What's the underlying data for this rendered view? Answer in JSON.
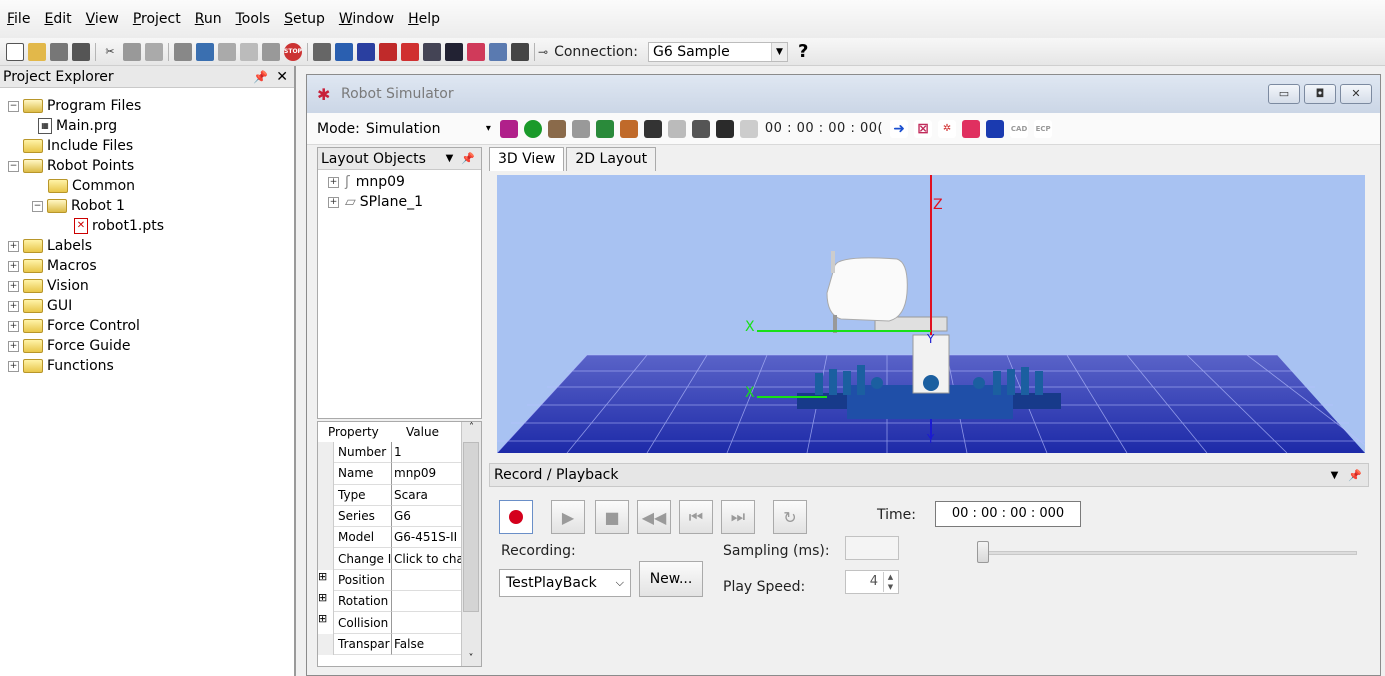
{
  "menu": [
    "File",
    "Edit",
    "View",
    "Project",
    "Run",
    "Tools",
    "Setup",
    "Window",
    "Help"
  ],
  "toolbar": {
    "connection_label": "Connection:",
    "connection_value": "G6 Sample",
    "help": "?"
  },
  "explorer": {
    "title": "Project Explorer",
    "items": [
      {
        "label": "Program Files"
      },
      {
        "label": "Main.prg"
      },
      {
        "label": "Include Files"
      },
      {
        "label": "Robot Points"
      },
      {
        "label": "Common"
      },
      {
        "label": "Robot 1"
      },
      {
        "label": "robot1.pts"
      },
      {
        "label": "Labels"
      },
      {
        "label": "Macros"
      },
      {
        "label": "Vision"
      },
      {
        "label": "GUI"
      },
      {
        "label": "Force Control"
      },
      {
        "label": "Force Guide"
      },
      {
        "label": "Functions"
      }
    ]
  },
  "simulator": {
    "title": "Robot Simulator",
    "mode_label": "Mode:",
    "mode_value": "Simulation",
    "time_display": "00 : 00 : 00 : 00(",
    "layout_title": "Layout Objects",
    "layout_items": [
      "mnp09",
      "SPlane_1"
    ],
    "tabs": [
      "3D View",
      "2D Layout"
    ],
    "axis_labels": {
      "z": "Z",
      "x": "X",
      "y": "Y"
    },
    "properties": {
      "header": [
        "Property",
        "Value"
      ],
      "rows": [
        [
          "Number",
          "1"
        ],
        [
          "Name",
          "mnp09"
        ],
        [
          "Type",
          "Scara"
        ],
        [
          "Series",
          "G6"
        ],
        [
          "Model",
          "G6-451S-II"
        ],
        [
          "Change I",
          "Click to cha"
        ],
        [
          "Position",
          ""
        ],
        [
          "Rotation",
          ""
        ],
        [
          "Collision",
          ""
        ],
        [
          "Transpar",
          "False"
        ]
      ]
    },
    "record": {
      "title": "Record / Playback",
      "time_label": "Time:",
      "time_value": "00 : 00 : 00 : 000",
      "recording_label": "Recording:",
      "recording_value": "TestPlayBack",
      "new_button": "New...",
      "sampling_label": "Sampling (ms):",
      "play_speed_label": "Play Speed:",
      "play_speed_value": "4"
    }
  }
}
